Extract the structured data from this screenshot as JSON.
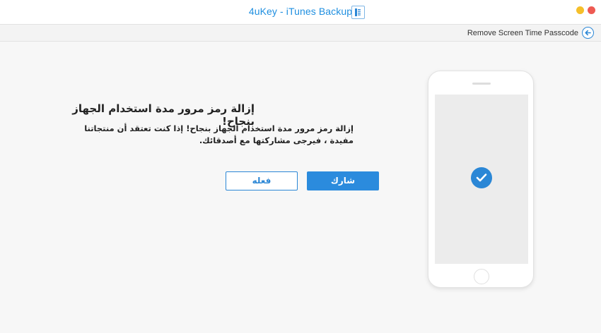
{
  "window": {
    "title": "4uKey - iTunes Backup",
    "menu_icon": "menu-icon",
    "controls": [
      "minimize-icon",
      "close-icon"
    ]
  },
  "subbar": {
    "back_label": "Remove Screen Time Passcode",
    "back_icon": "arrow-left-circle-icon"
  },
  "main": {
    "title": "إزالة رمز مرور مدة استخدام الجهاز بنجاح!",
    "description": "إزالة رمز مرور  مدة استخدام الجهاز  بنجاح! إذا كنت تعتقد أن منتجاتنا مفيدة ، فيرجى مشاركتها مع أصدقائك.",
    "buttons": {
      "done": "فعله",
      "share": "شارك"
    }
  },
  "illustration": {
    "icon": "check-circle-icon"
  },
  "colors": {
    "accent": "#2b87d6",
    "title_text": "#1f8fe0",
    "close": "#ee5a52",
    "minimize": "#f5bf2a"
  }
}
